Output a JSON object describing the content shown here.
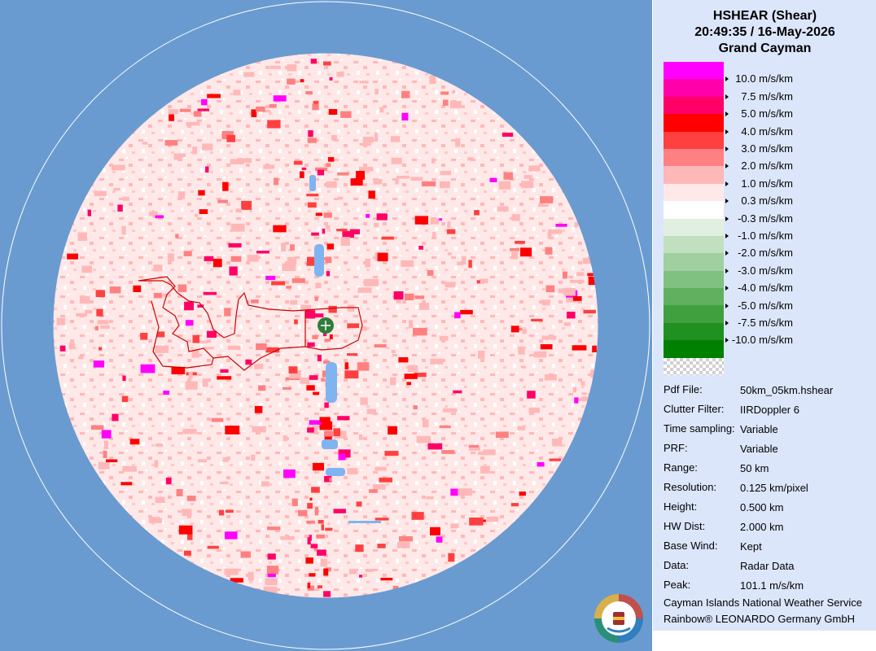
{
  "header": {
    "product": "HSHEAR (Shear)",
    "datetime": "20:49:35 / 16-May-2026",
    "site": "Grand Cayman"
  },
  "legend": [
    {
      "label": "10.0 m/s/km",
      "color": "#ff00ff"
    },
    {
      "label": "7.5 m/s/km",
      "color": "#ff00aa"
    },
    {
      "label": "5.0 m/s/km",
      "color": "#ff0066"
    },
    {
      "label": "4.0 m/s/km",
      "color": "#ff0000"
    },
    {
      "label": "3.0 m/s/km",
      "color": "#ff4040"
    },
    {
      "label": "2.0 m/s/km",
      "color": "#ff8080"
    },
    {
      "label": "1.0 m/s/km",
      "color": "#ffb8b8"
    },
    {
      "label": "0.3 m/s/km",
      "color": "#ffe8e8"
    },
    {
      "label": "-0.3 m/s/km",
      "color": "#ffffff"
    },
    {
      "label": "-1.0 m/s/km",
      "color": "#e0efe0"
    },
    {
      "label": "-2.0 m/s/km",
      "color": "#c0e0c0"
    },
    {
      "label": "-3.0 m/s/km",
      "color": "#a0d0a0"
    },
    {
      "label": "-4.0 m/s/km",
      "color": "#80c080"
    },
    {
      "label": "-5.0 m/s/km",
      "color": "#60b060"
    },
    {
      "label": "-7.5 m/s/km",
      "color": "#40a040"
    },
    {
      "label": "-10.0 m/s/km",
      "color": "#209020"
    }
  ],
  "legend_bottom_color": "#008000",
  "info": [
    {
      "key": "Pdf File:",
      "value": "50km_05km.hshear"
    },
    {
      "key": "Clutter Filter:",
      "value": "IIRDoppler 6"
    },
    {
      "key": "Time sampling:",
      "value": "Variable"
    },
    {
      "key": "PRF:",
      "value": "Variable"
    },
    {
      "key": "Range:",
      "value": "50 km"
    },
    {
      "key": "Resolution:",
      "value": "0.125 km/pixel"
    },
    {
      "key": "Height:",
      "value": "0.500 km"
    },
    {
      "key": "HW Dist:",
      "value": "2.000 km"
    },
    {
      "key": "Base Wind:",
      "value": "Kept"
    },
    {
      "key": "Data:",
      "value": "Radar Data"
    },
    {
      "key": "Peak:",
      "value": "101.1 m/s/km"
    }
  ],
  "credits": {
    "line1": "Cayman Islands National Weather Service",
    "line2": "Rainbow® LEONARDO Germany GmbH"
  },
  "colors": {
    "background": "#6a9bd0",
    "panel": "#dce6fb",
    "coastline": "#cc0000",
    "water": "#7fb4f0",
    "radar_marker": "#2e7d3c"
  },
  "icons": {
    "radar_site": "radar-site-icon",
    "logo": "cayman-weather-service-logo"
  }
}
